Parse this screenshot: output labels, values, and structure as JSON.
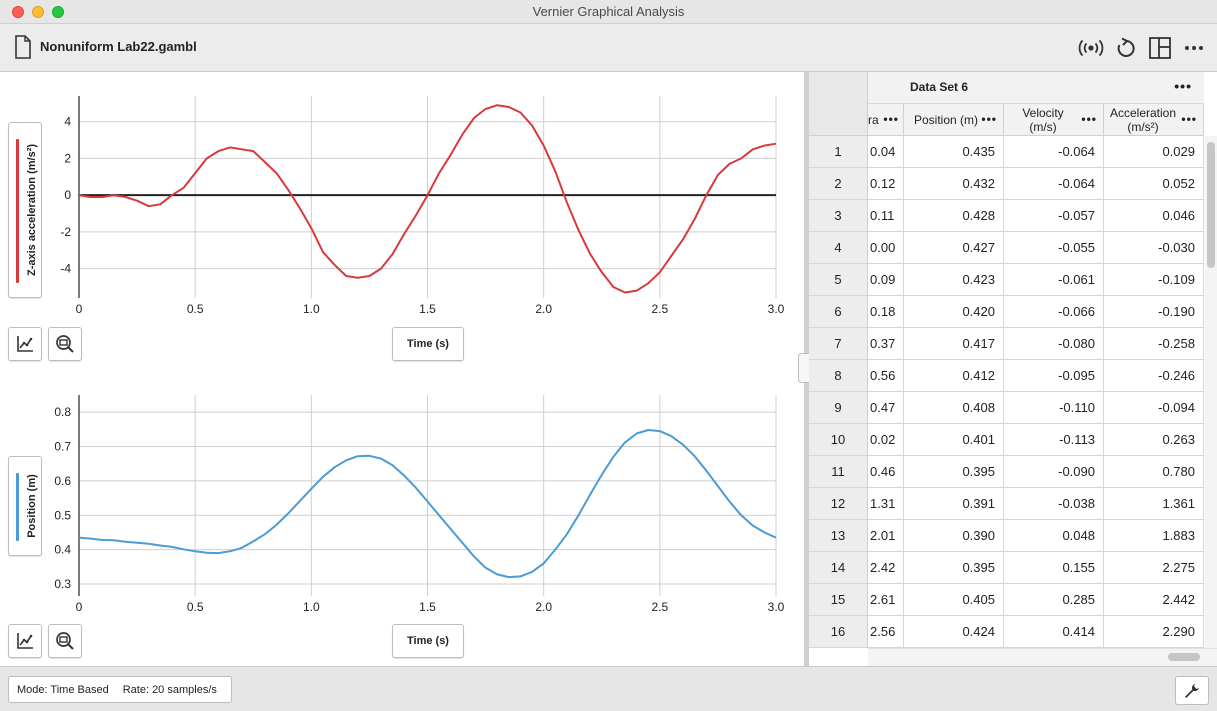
{
  "window": {
    "title": "Vernier Graphical Analysis"
  },
  "toolbar": {
    "filename": "Nonuniform Lab22.gambl",
    "icons": [
      "file-icon",
      "sensor-icon",
      "reset-icon",
      "layout-icon",
      "more-icon"
    ]
  },
  "graph1": {
    "ylabel": "Z-axis acceleration (m/s²)",
    "xlabel": "Time (s)",
    "series_color": "#d9393b",
    "chart_data": {
      "type": "line",
      "xlim": [
        0,
        3.0
      ],
      "ylim": [
        -5.6,
        5.4
      ],
      "xticks": [
        "0",
        "0.5",
        "1.0",
        "1.5",
        "2.0",
        "2.5",
        "3.0"
      ],
      "yticks": [
        "4",
        "2",
        "0",
        "-2",
        "-4"
      ],
      "x": [
        0,
        0.05,
        0.1,
        0.15,
        0.2,
        0.25,
        0.3,
        0.35,
        0.4,
        0.45,
        0.5,
        0.55,
        0.6,
        0.65,
        0.7,
        0.75,
        0.8,
        0.85,
        0.9,
        0.95,
        1.0,
        1.05,
        1.1,
        1.15,
        1.2,
        1.25,
        1.3,
        1.35,
        1.4,
        1.45,
        1.5,
        1.55,
        1.6,
        1.65,
        1.7,
        1.75,
        1.8,
        1.85,
        1.9,
        1.95,
        2.0,
        2.05,
        2.1,
        2.15,
        2.2,
        2.25,
        2.3,
        2.35,
        2.4,
        2.45,
        2.5,
        2.55,
        2.6,
        2.65,
        2.7,
        2.75,
        2.8,
        2.85,
        2.9,
        2.95,
        3.0
      ],
      "y": [
        0.0,
        -0.1,
        -0.1,
        0.0,
        -0.1,
        -0.3,
        -0.6,
        -0.5,
        0.0,
        0.4,
        1.2,
        2.0,
        2.4,
        2.6,
        2.5,
        2.4,
        1.8,
        1.2,
        0.3,
        -0.7,
        -1.8,
        -3.1,
        -3.8,
        -4.4,
        -4.5,
        -4.4,
        -4.0,
        -3.2,
        -2.1,
        -1.1,
        0.0,
        1.2,
        2.2,
        3.3,
        4.2,
        4.7,
        4.9,
        4.8,
        4.5,
        3.8,
        2.7,
        1.3,
        -0.4,
        -1.9,
        -3.2,
        -4.2,
        -5.0,
        -5.3,
        -5.2,
        -4.8,
        -4.2,
        -3.3,
        -2.4,
        -1.3,
        0.0,
        1.1,
        1.7,
        2.0,
        2.5,
        2.7,
        2.8
      ]
    }
  },
  "graph2": {
    "ylabel": "Position (m)",
    "xlabel": "Time (s)",
    "series_color": "#4c9bd6",
    "chart_data": {
      "type": "line",
      "xlim": [
        0,
        3.0
      ],
      "ylim": [
        0.265,
        0.85
      ],
      "xticks": [
        "0",
        "0.5",
        "1.0",
        "1.5",
        "2.0",
        "2.5",
        "3.0"
      ],
      "yticks": [
        "0.8",
        "0.7",
        "0.6",
        "0.5",
        "0.4",
        "0.3"
      ],
      "x": [
        0,
        0.05,
        0.1,
        0.15,
        0.2,
        0.25,
        0.3,
        0.35,
        0.4,
        0.45,
        0.5,
        0.55,
        0.6,
        0.65,
        0.7,
        0.75,
        0.8,
        0.85,
        0.9,
        0.95,
        1.0,
        1.05,
        1.1,
        1.15,
        1.2,
        1.25,
        1.3,
        1.35,
        1.4,
        1.45,
        1.5,
        1.55,
        1.6,
        1.65,
        1.7,
        1.75,
        1.8,
        1.85,
        1.9,
        1.95,
        2.0,
        2.05,
        2.1,
        2.15,
        2.2,
        2.25,
        2.3,
        2.35,
        2.4,
        2.45,
        2.5,
        2.55,
        2.6,
        2.65,
        2.7,
        2.75,
        2.8,
        2.85,
        2.9,
        2.95,
        3.0
      ],
      "y": [
        0.435,
        0.432,
        0.428,
        0.427,
        0.423,
        0.42,
        0.417,
        0.412,
        0.408,
        0.401,
        0.395,
        0.391,
        0.39,
        0.395,
        0.405,
        0.424,
        0.445,
        0.472,
        0.505,
        0.541,
        0.577,
        0.612,
        0.64,
        0.66,
        0.672,
        0.673,
        0.665,
        0.645,
        0.615,
        0.58,
        0.54,
        0.5,
        0.46,
        0.42,
        0.38,
        0.347,
        0.328,
        0.32,
        0.322,
        0.335,
        0.36,
        0.4,
        0.445,
        0.5,
        0.56,
        0.618,
        0.67,
        0.712,
        0.738,
        0.748,
        0.745,
        0.73,
        0.705,
        0.672,
        0.63,
        0.585,
        0.54,
        0.5,
        0.47,
        0.45,
        0.435
      ]
    }
  },
  "table": {
    "dataset_name": "Data Set 6",
    "columns": [
      {
        "label": "ra"
      },
      {
        "label": "Position (m)"
      },
      {
        "label_line1": "Velocity",
        "label_line2": "(m/s)"
      },
      {
        "label_line1": "Acceleration",
        "label_line2": "(m/s²)"
      }
    ],
    "rows": [
      {
        "idx": "1",
        "c0": "0.04",
        "pos": "0.435",
        "vel": "-0.064",
        "acc": "0.029"
      },
      {
        "idx": "2",
        "c0": "0.12",
        "pos": "0.432",
        "vel": "-0.064",
        "acc": "0.052"
      },
      {
        "idx": "3",
        "c0": "0.11",
        "pos": "0.428",
        "vel": "-0.057",
        "acc": "0.046"
      },
      {
        "idx": "4",
        "c0": "0.00",
        "pos": "0.427",
        "vel": "-0.055",
        "acc": "-0.030"
      },
      {
        "idx": "5",
        "c0": "0.09",
        "pos": "0.423",
        "vel": "-0.061",
        "acc": "-0.109"
      },
      {
        "idx": "6",
        "c0": "0.18",
        "pos": "0.420",
        "vel": "-0.066",
        "acc": "-0.190"
      },
      {
        "idx": "7",
        "c0": "0.37",
        "pos": "0.417",
        "vel": "-0.080",
        "acc": "-0.258"
      },
      {
        "idx": "8",
        "c0": "0.56",
        "pos": "0.412",
        "vel": "-0.095",
        "acc": "-0.246"
      },
      {
        "idx": "9",
        "c0": "0.47",
        "pos": "0.408",
        "vel": "-0.110",
        "acc": "-0.094"
      },
      {
        "idx": "10",
        "c0": "0.02",
        "pos": "0.401",
        "vel": "-0.113",
        "acc": "0.263"
      },
      {
        "idx": "11",
        "c0": "0.46",
        "pos": "0.395",
        "vel": "-0.090",
        "acc": "0.780"
      },
      {
        "idx": "12",
        "c0": "1.31",
        "pos": "0.391",
        "vel": "-0.038",
        "acc": "1.361"
      },
      {
        "idx": "13",
        "c0": "2.01",
        "pos": "0.390",
        "vel": "0.048",
        "acc": "1.883"
      },
      {
        "idx": "14",
        "c0": "2.42",
        "pos": "0.395",
        "vel": "0.155",
        "acc": "2.275"
      },
      {
        "idx": "15",
        "c0": "2.61",
        "pos": "0.405",
        "vel": "0.285",
        "acc": "2.442"
      },
      {
        "idx": "16",
        "c0": "2.56",
        "pos": "0.424",
        "vel": "0.414",
        "acc": "2.290"
      }
    ]
  },
  "status": {
    "mode": "Mode: Time Based",
    "rate": "Rate: 20 samples/s"
  }
}
